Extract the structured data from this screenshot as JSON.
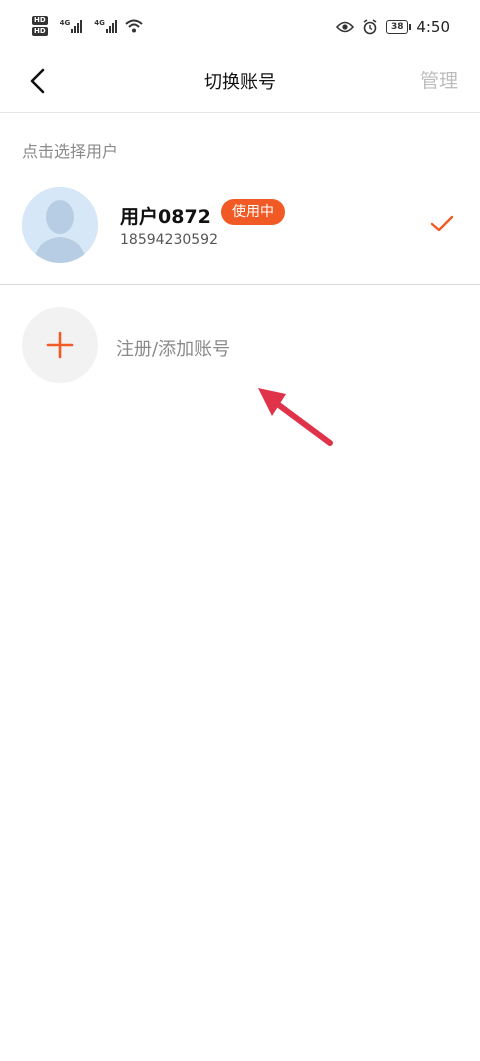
{
  "status_bar": {
    "hd_label": "HD",
    "net_label": "4G",
    "battery": "38",
    "time": "4:50"
  },
  "header": {
    "title": "切换账号",
    "manage_label": "管理"
  },
  "section": {
    "label": "点击选择用户"
  },
  "account": {
    "name": "用户0872",
    "badge": "使用中",
    "phone": "18594230592"
  },
  "add_account": {
    "label": "注册/添加账号"
  },
  "colors": {
    "accent": "#f15a24",
    "annotation_arrow": "#e0334a"
  }
}
